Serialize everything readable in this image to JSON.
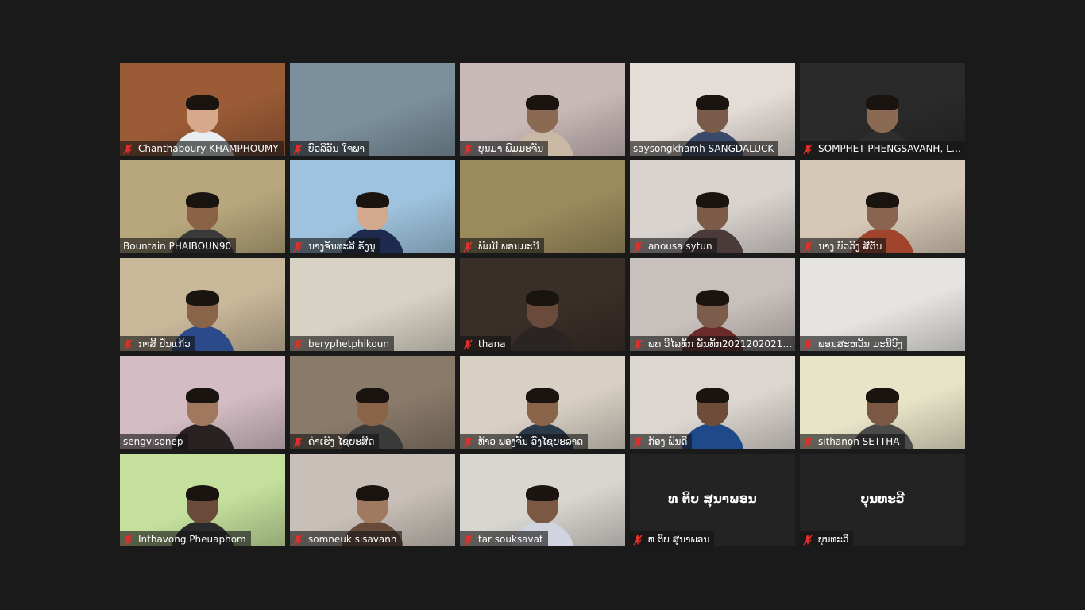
{
  "meeting": {
    "participants": [
      {
        "name": "Chanthaboury KHAMPHOUMY",
        "muted": true,
        "video": true,
        "bg": "#9a5b36",
        "skin": "#d8a88c",
        "shirt": "#e8eef2"
      },
      {
        "name": "ບົວລິວັນ ໃຈພາ",
        "muted": true,
        "video": true,
        "bg": "#7b8f9c",
        "skin": "",
        "shirt": ""
      },
      {
        "name": "ບຸນມາ ພົມມະຈັນ",
        "muted": true,
        "video": true,
        "bg": "#c9b8b8",
        "skin": "#8b6a54",
        "shirt": "#c8b8a4"
      },
      {
        "name": "saysongkhamh SANGDALUCK",
        "muted": false,
        "video": true,
        "bg": "#e4dcd6",
        "skin": "#7a5a48",
        "shirt": "#3a4a6a"
      },
      {
        "name": "SOMPHET PHENGSAVANH, LA...",
        "muted": true,
        "video": true,
        "bg": "#2a2a2a",
        "skin": "#8a6a52",
        "shirt": "#2e2e2e"
      },
      {
        "name": "Bountain PHAIBOUN90",
        "muted": false,
        "video": true,
        "bg": "#b8a77c",
        "skin": "#8a6246",
        "shirt": "#3a3a3a"
      },
      {
        "name": "ນາງຈັນທະລີ ຣັງນູ",
        "muted": true,
        "video": true,
        "bg": "#9fc3de",
        "skin": "#d2a98c",
        "shirt": "#1e2a4e"
      },
      {
        "name": "ພົມມີ ພອນມະນີ",
        "muted": true,
        "video": true,
        "bg": "#9b8a5c",
        "skin": "",
        "shirt": ""
      },
      {
        "name": "anousa    sytun",
        "muted": true,
        "video": true,
        "bg": "#d9d3cf",
        "skin": "#7c5b48",
        "shirt": "#4a3a3a"
      },
      {
        "name": "ນາງ ບົວວົງ ສີຕັນ",
        "muted": true,
        "video": true,
        "bg": "#d6c8b6",
        "skin": "#8a6450",
        "shirt": "#a0442e"
      },
      {
        "name": "ກາສີ ປິ່ນແກ້ວ",
        "muted": true,
        "video": true,
        "bg": "#c9b79a",
        "skin": "#8a6448",
        "shirt": "#2a4a8a"
      },
      {
        "name": "beryphetphikoun",
        "muted": true,
        "video": true,
        "bg": "#d8d2c4",
        "skin": "",
        "shirt": ""
      },
      {
        "name": "thana",
        "muted": true,
        "video": true,
        "bg": "#3a2e28",
        "skin": "#6a4a3a",
        "shirt": "#2a2422"
      },
      {
        "name": "ພທ ວິໄລທັກ ພັນທັກ20212020212...",
        "muted": true,
        "video": true,
        "bg": "#c8c0bc",
        "skin": "#7c5c4a",
        "shirt": "#6a2a2a"
      },
      {
        "name": "ພອນສະຫວັນ ມະນີວົງ",
        "muted": true,
        "video": true,
        "bg": "#e6e4e0",
        "skin": "",
        "shirt": "#4a4038"
      },
      {
        "name": "sengvisonep",
        "muted": false,
        "video": true,
        "bg": "#d4bcc4",
        "skin": "#a0785e",
        "shirt": "#2a2222"
      },
      {
        "name": "ຄຳເຮັງ ໄຊຍະສິດ",
        "muted": true,
        "video": true,
        "bg": "#8a7a6a",
        "skin": "#8a6448",
        "shirt": "#3a3a3a"
      },
      {
        "name": "ທ້າວ ພອງຈັນ ວົງໄຊຍະລາດ",
        "muted": true,
        "video": true,
        "bg": "#d8d0c4",
        "skin": "#8a6448",
        "shirt": "#2a3a4a"
      },
      {
        "name": "ກ້ອງ  ພັນດີ",
        "muted": true,
        "video": true,
        "bg": "#dcd6d0",
        "skin": "#6e4c3a",
        "shirt": "#1e4a8a"
      },
      {
        "name": "sithanon SETTHA",
        "muted": true,
        "video": true,
        "bg": "#e8e4c8",
        "skin": "#7a5844",
        "shirt": "#4a4a4a"
      },
      {
        "name": "Inthavong Pheuaphom",
        "muted": true,
        "video": true,
        "bg": "#c4e09c",
        "skin": "#6a4a38",
        "shirt": "#2a2a2a"
      },
      {
        "name": "somneuk sisavanh",
        "muted": true,
        "video": true,
        "bg": "#c8c0b8",
        "skin": "#a07a60",
        "shirt": "#6a4a3a"
      },
      {
        "name": "tar souksavat",
        "muted": true,
        "video": true,
        "bg": "#d8d6d0",
        "skin": "#7a5844",
        "shirt": "#d0d4e0"
      },
      {
        "name": "ທ ຕິບ ສຸນາພອນ",
        "muted": true,
        "video": false,
        "bg": "#232323",
        "skin": "",
        "shirt": ""
      },
      {
        "name": "ບຸນທະວີ",
        "muted": true,
        "video": false,
        "bg": "#232323",
        "skin": "",
        "shirt": ""
      }
    ],
    "icons": {
      "muted": "microphone-muted-icon"
    },
    "colors": {
      "muted_icon": "#e0302a",
      "background": "#1a1a1a"
    }
  }
}
